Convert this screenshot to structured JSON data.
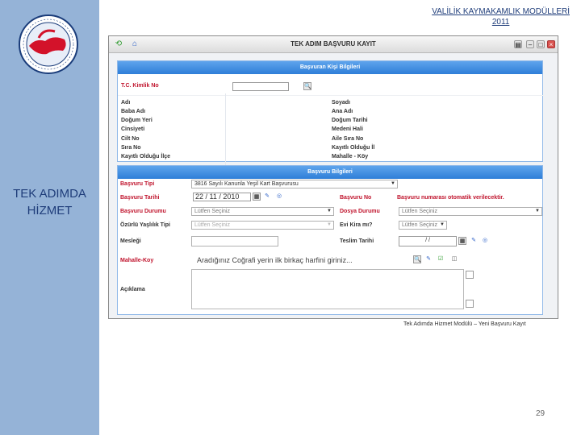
{
  "slide": {
    "header_line1": "VALİLİK KAYMAKAMLIK MODÜLLERİ",
    "header_line2": "2011",
    "side_title_line1": "TEK ADIMDA",
    "side_title_line2": "HİZMET",
    "caption": "Tek Adımda Hizmet Modülü – Yeni Başvuru Kayıt",
    "page_number": "29"
  },
  "window": {
    "title": "TEK ADIM BAŞVURU KAYIT"
  },
  "applicant_panel": {
    "heading": "Başvuran Kişi Bilgileri",
    "tc_label": "T.C. Kimlik No",
    "left_labels": [
      "Adı",
      "Baba Adı",
      "Doğum Yeri",
      "Cinsiyeti",
      "Cilt No",
      "Sıra No",
      "Kayıtlı Olduğu İlçe"
    ],
    "right_labels": [
      "Soyadı",
      "Ana Adı",
      "Doğum Tarihi",
      "Medeni Hali",
      "Aile Sıra No",
      "Kayıtlı Olduğu İl",
      "Mahalle - Köy"
    ]
  },
  "application_panel": {
    "heading": "Başvuru Bilgileri",
    "type_label": "Başvuru Tipi",
    "type_value": "3816 Sayılı Kanunla Yeşil Kart Başvurusu",
    "date_label": "Başvuru Tarihi",
    "date_value": "22 / 11 / 2010",
    "status_label": "Başvuru Durumu",
    "status_value": "Lütfen Seçiniz",
    "disability_label": "Özürlü Yaşlılık Tipi",
    "disability_value": "Lütfen Seçiniz",
    "job_label": "Mesleği",
    "village_label": "Mahalle-Koy",
    "village_placeholder": "Aradığınız Coğrafi yerin ilk birkaç harfini giriniz...",
    "note_label": "Açıklama",
    "app_no_label": "Başvuru No",
    "app_no_value": "Başvuru numarası otomatik verilecektir.",
    "file_status_label": "Dosya Durumu",
    "file_status_value": "Lütfen Seçiniz",
    "rent_label": "Evi Kira mı?",
    "rent_value": "Lütfen Seçiniz",
    "delivery_label": "Teslim Tarihi",
    "delivery_value": "/ /"
  }
}
